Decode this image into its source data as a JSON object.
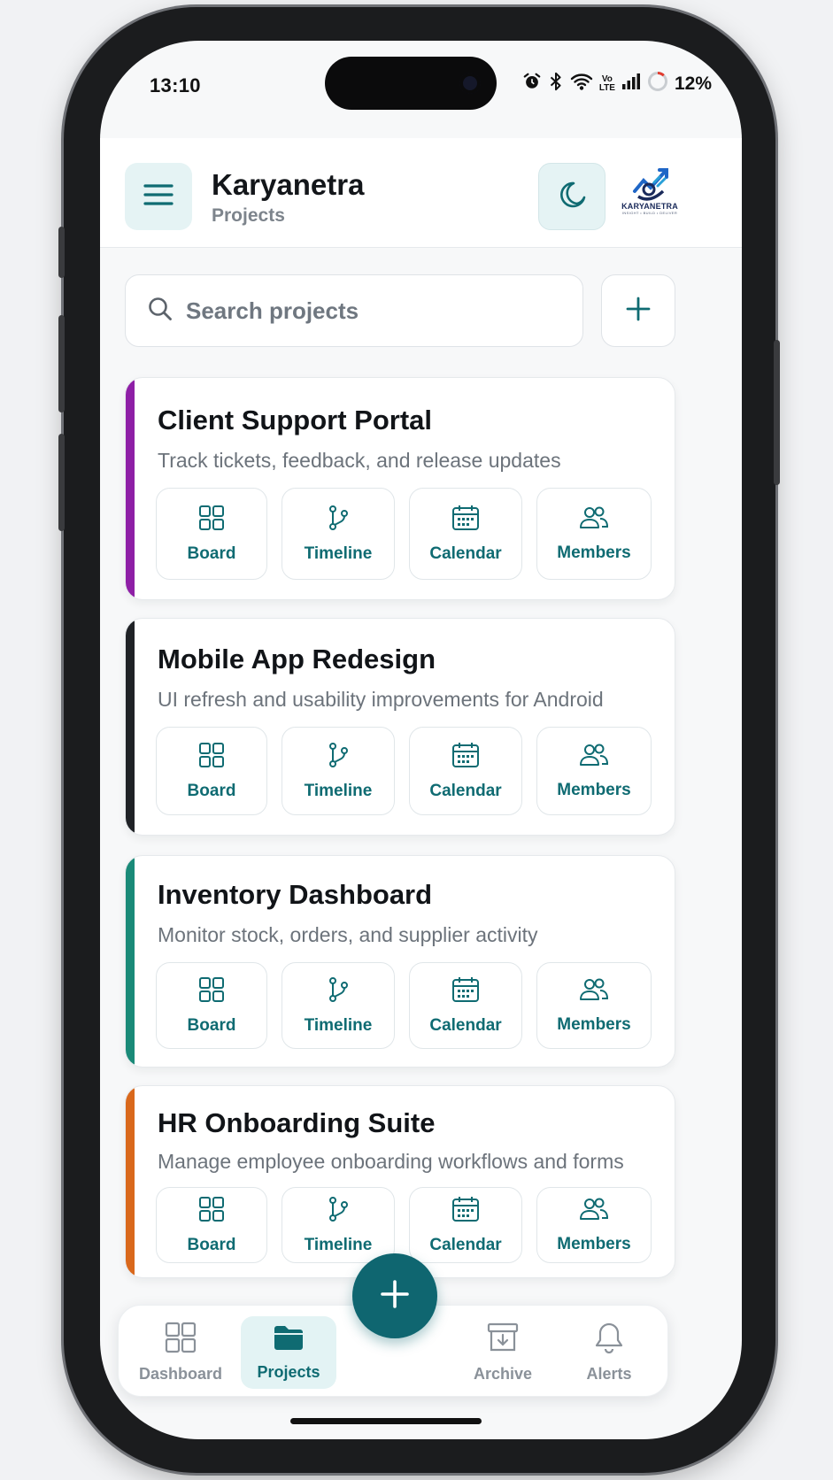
{
  "status_bar": {
    "time": "13:10",
    "battery_percent": "12%",
    "network_label_top": "Vo",
    "network_label_bottom": "LTE",
    "icons": [
      "alarm-icon",
      "bluetooth-icon",
      "wifi-icon",
      "signal-icon",
      "battery-ring-icon"
    ]
  },
  "header": {
    "title": "Karyanetra",
    "subtitle": "Projects",
    "menu_icon": "hamburger-menu-icon",
    "theme_icon": "moon-icon",
    "logo_text": "KARYANETRA",
    "logo_tagline": "INSIGHT • BUILD • DELIVER"
  },
  "search": {
    "placeholder": "Search projects",
    "value": ""
  },
  "projects": [
    {
      "title": "Client Support Portal",
      "description": "Track tickets, feedback, and release updates",
      "accent": "#8e1fa6",
      "actions": [
        "Board",
        "Timeline",
        "Calendar",
        "Members"
      ]
    },
    {
      "title": "Mobile App Redesign",
      "description": "UI refresh and usability improvements for Android",
      "accent": "#1f2226",
      "actions": [
        "Board",
        "Timeline",
        "Calendar",
        "Members"
      ]
    },
    {
      "title": "Inventory Dashboard",
      "description": "Monitor stock, orders, and supplier activity",
      "accent": "#1a8a78",
      "actions": [
        "Board",
        "Timeline",
        "Calendar",
        "Members"
      ]
    },
    {
      "title": "HR Onboarding Suite",
      "description": "Manage employee onboarding workflows and forms",
      "accent": "#d9681c",
      "actions": [
        "Board",
        "Timeline",
        "Calendar",
        "Members"
      ]
    }
  ],
  "bottom_nav": {
    "items": [
      {
        "label": "Dashboard",
        "icon": "grid-icon",
        "active": false
      },
      {
        "label": "Projects",
        "icon": "folder-icon",
        "active": true
      },
      {
        "label": "Archive",
        "icon": "archive-icon",
        "active": false
      },
      {
        "label": "Alerts",
        "icon": "bell-icon",
        "active": false
      }
    ],
    "fab_icon": "plus-icon"
  },
  "colors": {
    "brand_teal": "#0f6b72",
    "fab_teal": "#0f6670",
    "tint": "#e5f3f4"
  }
}
